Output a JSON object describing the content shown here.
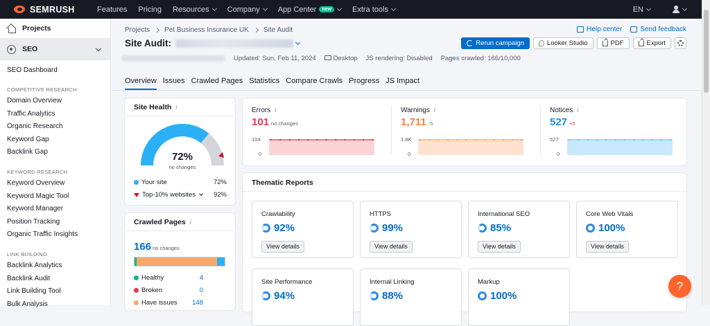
{
  "topbar": {
    "brand": "SEMRUSH",
    "nav": [
      {
        "label": "Features",
        "dropdown": false
      },
      {
        "label": "Pricing",
        "dropdown": false
      },
      {
        "label": "Resources",
        "dropdown": true
      },
      {
        "label": "Company",
        "dropdown": true
      },
      {
        "label": "App Center",
        "dropdown": true,
        "badge": "new"
      },
      {
        "label": "Extra tools",
        "dropdown": true
      }
    ],
    "language": "EN"
  },
  "sidebar": {
    "projects": "Projects",
    "seo": "SEO",
    "dashboard": "SEO Dashboard",
    "sections": [
      {
        "title": "COMPETITIVE RESEARCH",
        "items": [
          "Domain Overview",
          "Traffic Analytics",
          "Organic Research",
          "Keyword Gap",
          "Backlink Gap"
        ]
      },
      {
        "title": "KEYWORD RESEARCH",
        "items": [
          "Keyword Overview",
          "Keyword Magic Tool",
          "Keyword Manager",
          "Position Tracking",
          "Organic Traffic Insights"
        ]
      },
      {
        "title": "LINK BUILDING",
        "items": [
          "Backlink Analytics",
          "Backlink Audit",
          "Link Building Tool",
          "Bulk Analysis"
        ]
      }
    ]
  },
  "breadcrumb": [
    "Projects",
    "Pet Business Insurance UK",
    "Site Audit"
  ],
  "toplinks": {
    "help": "Help center",
    "feedback": "Send feedback"
  },
  "title": "Site Audit:",
  "actions": {
    "rerun": "Rerun campaign",
    "looker": "Looker Studio",
    "pdf": "PDF",
    "export": "Export"
  },
  "meta": {
    "updated": "Updated: Sun, Feb 11, 2024",
    "device": "Desktop",
    "js": "JS rendering: Disabled",
    "crawled": "Pages crawled: 166/10,000"
  },
  "tabs": [
    "Overview",
    "Issues",
    "Crawled Pages",
    "Statistics",
    "Compare Crawls",
    "Progress",
    "JS Impact"
  ],
  "site_health": {
    "title": "Site Health",
    "value": "72%",
    "value_fraction": 0.72,
    "top10_fraction": 0.92,
    "subtitle": "no changes",
    "legend": [
      {
        "label": "Your site",
        "value": "72%",
        "color": "#2bb0f5"
      },
      {
        "label": "Top-10% websites",
        "value": "92%",
        "color": "#c8102e"
      }
    ]
  },
  "crawled_pages": {
    "title": "Crawled Pages",
    "value": "166",
    "subtitle": "no changes",
    "rows": [
      {
        "label": "Healthy",
        "value": "4",
        "color": "#00b88a"
      },
      {
        "label": "Broken",
        "value": "0",
        "color": "#e5384f"
      },
      {
        "label": "Have issues",
        "value": "148",
        "color": "#f7a76a"
      }
    ],
    "bar": [
      {
        "fraction": 0.024,
        "color": "#00b88a"
      },
      {
        "fraction": 0.892,
        "color": "#f7a76a"
      },
      {
        "fraction": 0.084,
        "color": "#2bb0f5"
      }
    ]
  },
  "metrics": [
    {
      "label": "Errors",
      "value": "101",
      "delta": "no changes",
      "color": "#e5384f",
      "delta_color": "#555b6a",
      "max_tick": "104",
      "min_tick": "0",
      "fill": "#fbd3d6",
      "line": "#e5384f"
    },
    {
      "label": "Warnings",
      "value": "1,711",
      "delta": "-5",
      "color": "#f5813b",
      "delta_color": "#2e9e6a",
      "max_tick": "1.8K",
      "min_tick": "0",
      "fill": "#fde3cf",
      "line": "#f5a56d"
    },
    {
      "label": "Notices",
      "value": "527",
      "delta": "+5",
      "color": "#1b8ce0",
      "delta_color": "#e5384f",
      "max_tick": "527",
      "min_tick": "0",
      "fill": "#c9e8fb",
      "line": "#7dc4f0"
    }
  ],
  "thematic": {
    "title": "Thematic Reports",
    "view_label": "View details",
    "reports": [
      {
        "name": "Crawlability",
        "value": "92%",
        "has_button": true
      },
      {
        "name": "HTTPS",
        "value": "99%",
        "has_button": true
      },
      {
        "name": "International SEO",
        "value": "85%",
        "has_button": true
      },
      {
        "name": "Core Web Vitals",
        "value": "100%",
        "has_button": true
      },
      {
        "name": "Site Performance",
        "value": "94%",
        "has_button": false
      },
      {
        "name": "Internal Linking",
        "value": "88%",
        "has_button": false
      },
      {
        "name": "Markup",
        "value": "100%",
        "has_button": false
      }
    ]
  },
  "help_fab": "?"
}
